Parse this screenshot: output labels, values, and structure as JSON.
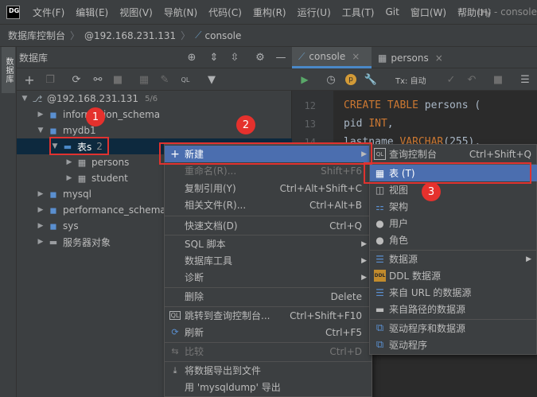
{
  "app": {
    "logo": "DG",
    "window_title": "try - console"
  },
  "menu": [
    "文件(F)",
    "编辑(E)",
    "视图(V)",
    "导航(N)",
    "代码(C)",
    "重构(R)",
    "运行(U)",
    "工具(T)",
    "Git",
    "窗口(W)",
    "帮助(H)"
  ],
  "breadcrumb": [
    "数据库控制台",
    "@192.168.231.131",
    "console"
  ],
  "side_tab": "数据库",
  "db_panel": {
    "title": "数据库"
  },
  "tree": {
    "root": {
      "label": "@192.168.231.131",
      "badge": "5/6"
    },
    "info_schema": "information_schema",
    "mydb1": "mydb1",
    "tables": {
      "label": "表s",
      "count": "2"
    },
    "persons": "persons",
    "student": "student",
    "mysql": "mysql",
    "perf_schema": "performance_schema",
    "sys": "sys",
    "server_objects": "服务器对象"
  },
  "editor": {
    "tabs": [
      "console",
      "persons"
    ],
    "tx_label": "Tx: 自动",
    "line_numbers": [
      "12",
      "13",
      "14"
    ],
    "code": {
      "line12_kw": "CREATE TABLE",
      "line12_id": " persons (",
      "line13_id": "pid ",
      "line13_kw": "INT",
      "line13_tail": ",",
      "line14_id": "lastname ",
      "line14_kw": "VARCHAR",
      "line14_tail": "(255),"
    }
  },
  "context_menu": {
    "items": [
      {
        "label": "新建",
        "shortcut": ""
      },
      {
        "label": "重命名(R)...",
        "shortcut": "Shift+F6"
      },
      {
        "label": "复制引用(Y)",
        "shortcut": "Ctrl+Alt+Shift+C"
      },
      {
        "label": "相关文件(R)...",
        "shortcut": "Ctrl+Alt+B"
      },
      {
        "label": "快速文档(D)",
        "shortcut": "Ctrl+Q"
      },
      {
        "label": "SQL 脚本",
        "shortcut": ""
      },
      {
        "label": "数据库工具",
        "shortcut": ""
      },
      {
        "label": "诊断",
        "shortcut": ""
      },
      {
        "label": "删除",
        "shortcut": "Delete"
      },
      {
        "label": "跳转到查询控制台...",
        "shortcut": "Ctrl+Shift+F10"
      },
      {
        "label": "刷新",
        "shortcut": "Ctrl+F5"
      },
      {
        "label": "比较",
        "shortcut": "Ctrl+D"
      },
      {
        "label": "将数据导出到文件",
        "shortcut": ""
      },
      {
        "label": "用 'mysqldump' 导出",
        "shortcut": ""
      }
    ]
  },
  "submenu": {
    "items": [
      {
        "label": "查询控制台",
        "shortcut": "Ctrl+Shift+Q"
      },
      {
        "label": "表 (T)"
      },
      {
        "label": "视图"
      },
      {
        "label": "架构"
      },
      {
        "label": "用户"
      },
      {
        "label": "角色"
      },
      {
        "label": "数据源"
      },
      {
        "label": "DDL 数据源"
      },
      {
        "label": "来自 URL 的数据源"
      },
      {
        "label": "来自路径的数据源"
      },
      {
        "label": "驱动程序和数据源"
      },
      {
        "label": "驱动程序"
      }
    ]
  },
  "annotations": [
    "1",
    "2",
    "3"
  ],
  "colors": {
    "accent": "#4b6eaf",
    "annotation": "#e0322f",
    "keyword": "#cc7832",
    "string": "#6a8759"
  }
}
